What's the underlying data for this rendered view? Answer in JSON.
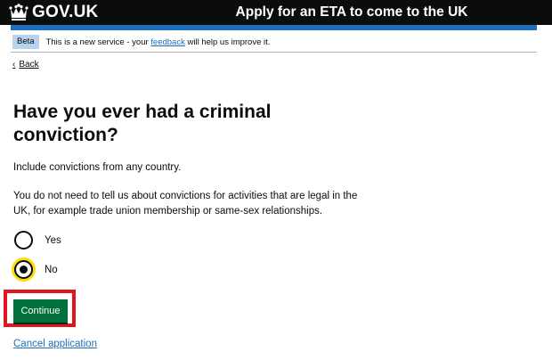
{
  "header": {
    "logo_text": "GOV.UK",
    "service_name": "Apply for an ETA to come to the UK"
  },
  "phase_banner": {
    "tag": "Beta",
    "text_before": "This is a new service - your",
    "link": "feedback",
    "text_after": "will help us improve it."
  },
  "back_link": "Back",
  "question": {
    "title": "Have you ever had a criminal conviction?",
    "hint1": "Include convictions from any country.",
    "hint2": "You do not need to tell us about convictions for activities that are legal in the UK, for example trade union membership or same-sex relationships.",
    "options": [
      {
        "label": "Yes",
        "selected": false
      },
      {
        "label": "No",
        "selected": true
      }
    ]
  },
  "continue_label": "Continue",
  "cancel_label": "Cancel application",
  "colors": {
    "header_bg": "#0b0c0c",
    "brand_blue": "#1d70b8",
    "button_green": "#00703c",
    "focus_yellow": "#ffdd00",
    "highlight_red": "#e3141f"
  }
}
